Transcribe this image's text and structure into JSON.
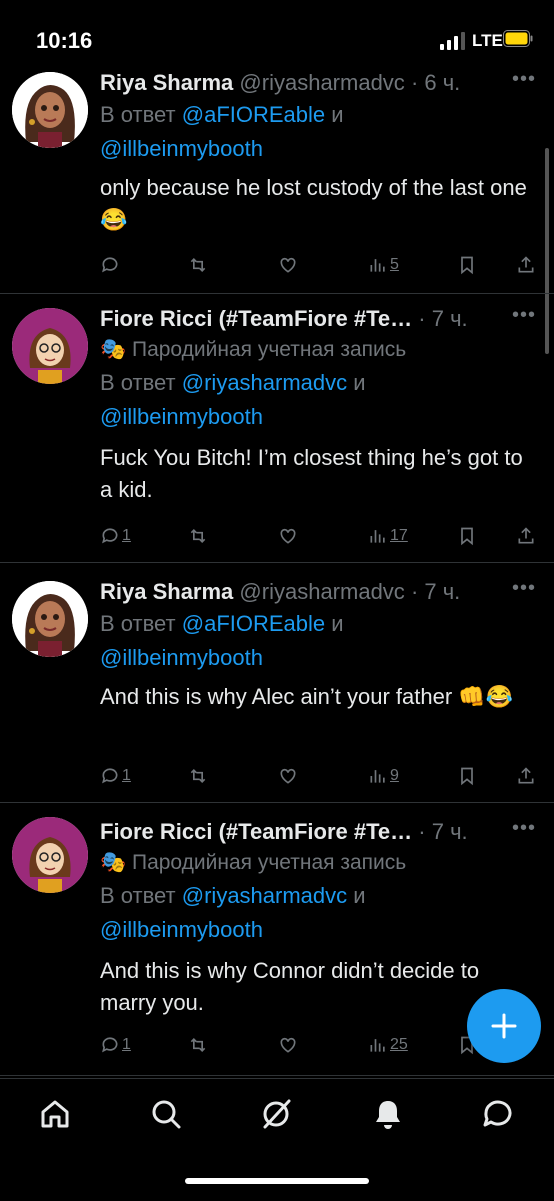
{
  "status": {
    "time": "10:16",
    "network": "LTE"
  },
  "tweets": [
    {
      "name": "Riya Sharma",
      "handle": "@riyasharmadvc",
      "time": "· 6 ч.",
      "more": "•••",
      "reply_prefix": "В ответ",
      "reply_to_1": "@aFIOREable",
      "reply_and": "и",
      "reply_to_2": "@illbeinmybooth",
      "text": "only because he lost custody of the last one😂",
      "replies": "",
      "views": "5"
    },
    {
      "name": "Fiore Ricci (#TeamFiore #Te…",
      "handle": "",
      "time": "· 7 ч.",
      "more": "•••",
      "parody": "🎭 Пародийная учетная запись",
      "reply_prefix": "В ответ",
      "reply_to_1": "@riyasharmadvc",
      "reply_and": "и",
      "reply_to_2": "@illbeinmybooth",
      "text": "Fuck You Bitch! I’m closest thing he’s got to a kid.",
      "replies": "1",
      "views": "17"
    },
    {
      "name": "Riya Sharma",
      "handle": "@riyasharmadvc",
      "time": "· 7 ч.",
      "more": "•••",
      "reply_prefix": "В ответ",
      "reply_to_1": "@aFIOREable",
      "reply_and": "и",
      "reply_to_2": "@illbeinmybooth",
      "text": "And this is why Alec ain’t your father 👊😂",
      "replies": "1",
      "views": "9"
    },
    {
      "name": "Fiore Ricci (#TeamFiore #Te…",
      "handle": "",
      "time": "· 7 ч.",
      "more": "•••",
      "parody": "🎭 Пародийная учетная запись",
      "reply_prefix": "В ответ",
      "reply_to_1": "@riyasharmadvc",
      "reply_and": "и",
      "reply_to_2": "@illbeinmybooth",
      "text": "And this is why Connor didn’t decide to marry you.",
      "replies": "1",
      "views": "25"
    }
  ],
  "icons": {
    "reply": "reply-icon",
    "retweet": "retweet-icon",
    "like": "like-icon",
    "views": "views-icon",
    "bookmark": "bookmark-icon",
    "share": "share-icon",
    "compose": "plus-icon",
    "nav": [
      "home-icon",
      "search-icon",
      "grok-icon",
      "notifications-icon",
      "messages-icon"
    ]
  },
  "colors": {
    "accent": "#1d9bf0",
    "muted": "#71767b",
    "text": "#e7e9ea",
    "background": "#000000",
    "battery": "#ffd60a"
  }
}
